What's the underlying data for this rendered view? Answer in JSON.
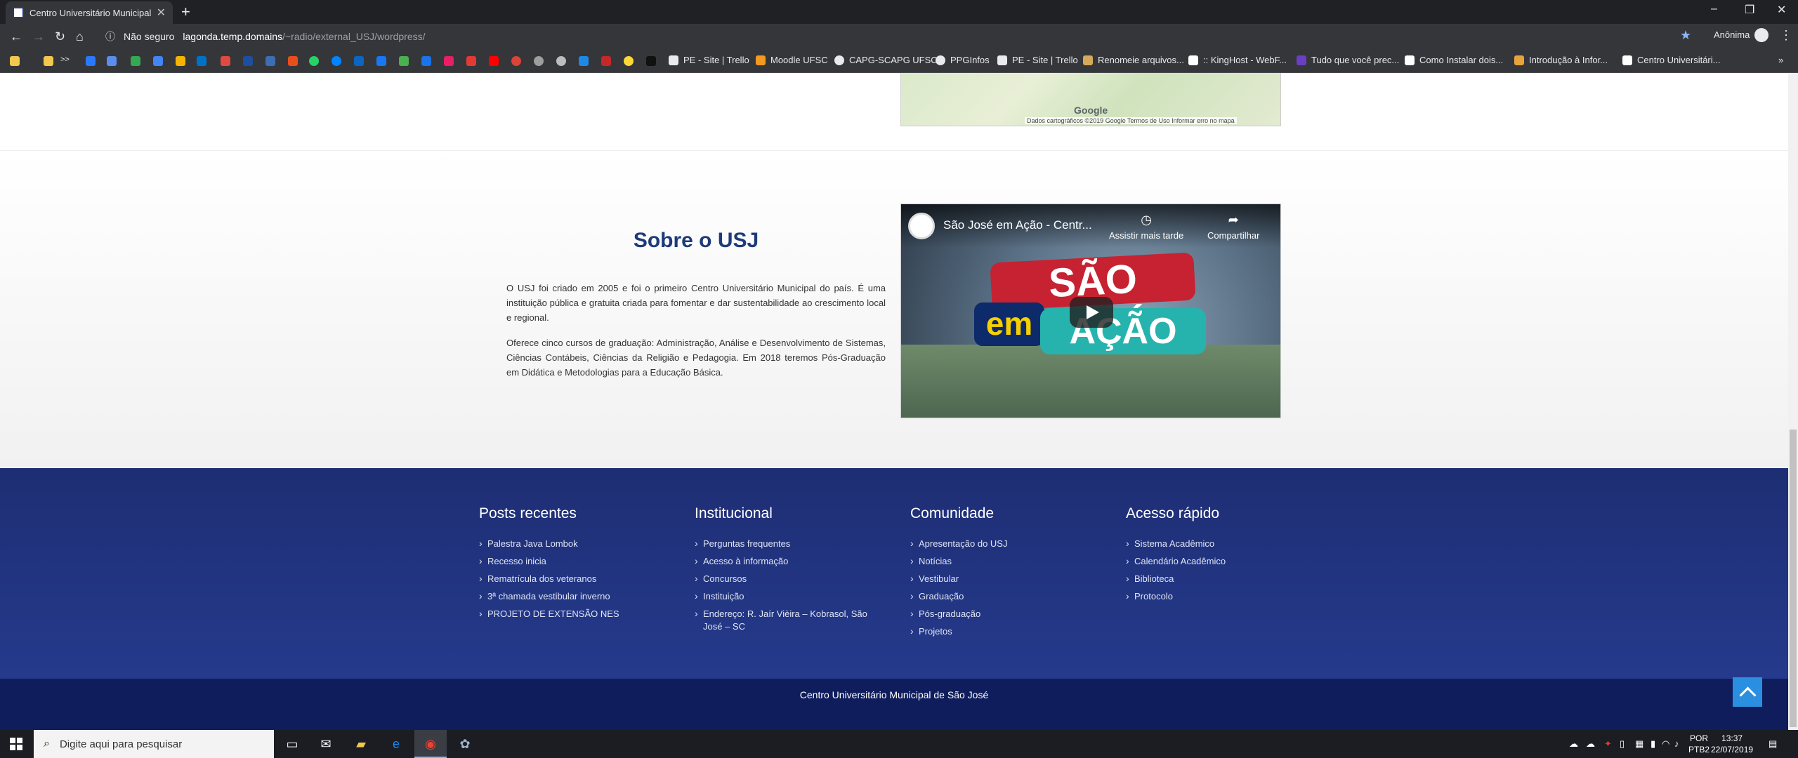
{
  "browser": {
    "tab_title": "Centro Universitário Municipal de São José",
    "new_tab": "+",
    "window_controls": [
      "–",
      "❐",
      "✕"
    ],
    "nav": {
      "back": "←",
      "forward": "→",
      "reload": "↻",
      "home": "⌂"
    },
    "security_label": "Não seguro",
    "url_host": "lagonda.temp.domains",
    "url_path": "/~radio/external_USJ/wordpress/",
    "profile": "Anônima",
    "menu": "⋮",
    "bookmarks": [
      {
        "label": "PE - Site | Trello",
        "color": "#e8eaed"
      },
      {
        "label": "Moodle UFSC",
        "color": "#f29a20"
      },
      {
        "label": "CAPG-SCAPG UFSC",
        "color": "#e8eaed"
      },
      {
        "label": "PPGInfos",
        "color": "#e8eaed"
      },
      {
        "label": "PE - Site | Trello",
        "color": "#e8eaed"
      },
      {
        "label": "Renomeie arquivos...",
        "color": "#d5a95c"
      },
      {
        "label": ":: KingHost - WebF...",
        "color": "#ffffff"
      },
      {
        "label": "Tudo que você prec...",
        "color": "#6a3fc1"
      },
      {
        "label": "Como Instalar dois...",
        "color": "#ffffff"
      },
      {
        "label": "Introdução à Infor...",
        "color": "#e8a33d"
      },
      {
        "label": "Centro Universitári...",
        "color": "#ffffff"
      }
    ],
    "bookmark_more": "»",
    "bookmark_folder_more": ">>"
  },
  "map": {
    "google_logo": "Google",
    "attribution": "Dados cartográficos ©2019 Google   Termos de Uso   Informar erro no mapa"
  },
  "about": {
    "title": "Sobre o USJ",
    "paragraph1": "O USJ foi criado em 2005 e foi o primeiro Centro Universitário Municipal do país. É uma instituição pública e gratuita criada para fomentar e dar sustentabilidade ao crescimento local e regional.",
    "paragraph2": "Oferece cinco cursos de graduação: Administração, Análise e Desenvolvimento de Sistemas, Ciências Contábeis, Ciências da Religião e Pedagogia. Em 2018 teremos Pós-Graduação em Didática e Metodologias para a Educação Básica."
  },
  "video": {
    "title": "São José em Ação - Centr...",
    "watch_later": "Assistir mais tarde",
    "share": "Compartilhar",
    "logo_line1": "SÃO JOSÉ",
    "logo_line2": "em",
    "logo_line3": "AÇÃO"
  },
  "footer": {
    "columns": [
      {
        "title": "Posts recentes",
        "items": [
          "Palestra Java Lombok",
          "Recesso inicia",
          "Rematrícula dos veteranos",
          "3ª chamada vestibular inverno",
          "PROJETO DE EXTENSÃO NES"
        ]
      },
      {
        "title": "Institucional",
        "items": [
          "Perguntas frequentes",
          "Acesso à informação",
          "Concursos",
          "Instituição",
          "Endereço: R. Jaír Vièira – Kobrasol, São José – SC"
        ]
      },
      {
        "title": "Comunidade",
        "items": [
          "Apresentação do USJ",
          "Notícias",
          "Vestibular",
          "Graduação",
          "Pós-graduação",
          "Projetos"
        ]
      },
      {
        "title": "Acesso rápido",
        "items": [
          "Sistema Acadêmico",
          "Calendário Acadêmico",
          "Biblioteca",
          "Protocolo"
        ]
      }
    ],
    "copyright": "Centro Universitário Municipal de São José"
  },
  "taskbar": {
    "search_placeholder": "Digite aqui para pesquisar",
    "lang_line1": "POR",
    "lang_line2": "PTB2",
    "time": "13:37",
    "date": "22/07/2019"
  },
  "colors": {
    "brand_blue": "#1f3a7a",
    "footer_blue": "#253a8c",
    "footer_bottom": "#0f1d5c",
    "to_top": "#2a8fe0"
  }
}
